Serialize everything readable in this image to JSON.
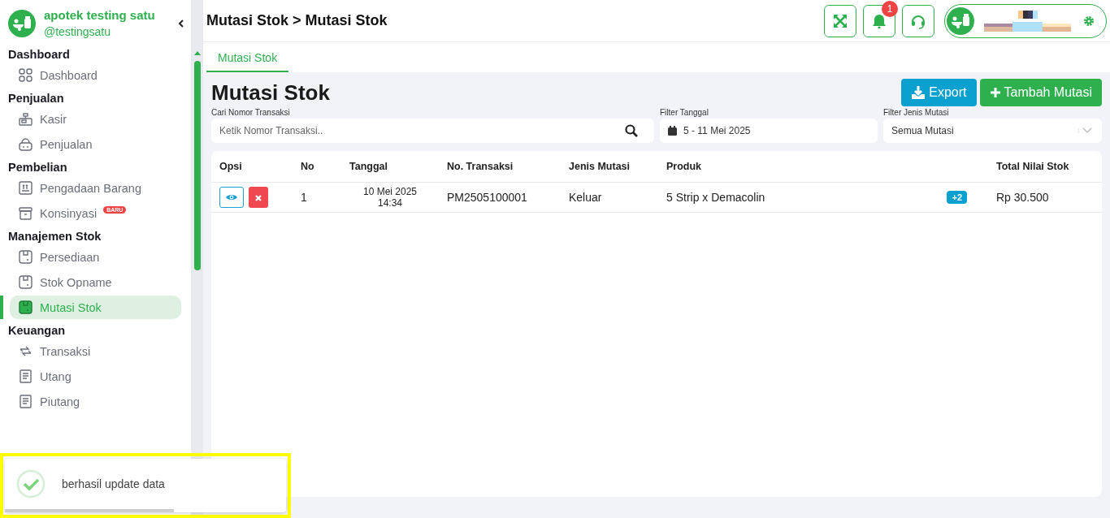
{
  "brand": {
    "name": "apotek testing satu",
    "handle": "@testingsatu"
  },
  "sidebar": {
    "sections": [
      {
        "title": "Dashboard",
        "items": [
          {
            "label": "Dashboard",
            "selected": false
          }
        ]
      },
      {
        "title": "Penjualan",
        "items": [
          {
            "label": "Kasir",
            "selected": false
          },
          {
            "label": "Penjualan",
            "selected": false
          }
        ]
      },
      {
        "title": "Pembelian",
        "items": [
          {
            "label": "Pengadaan Barang",
            "selected": false
          },
          {
            "label": "Konsinyasi",
            "badge": "BARU",
            "selected": false
          }
        ]
      },
      {
        "title": "Manajemen Stok",
        "items": [
          {
            "label": "Persediaan",
            "selected": false
          },
          {
            "label": "Stok Opname",
            "selected": false
          },
          {
            "label": "Mutasi Stok",
            "selected": true
          }
        ]
      },
      {
        "title": "Keuangan",
        "items": [
          {
            "label": "Transaksi",
            "selected": false
          },
          {
            "label": "Utang",
            "selected": false
          },
          {
            "label": "Piutang",
            "selected": false
          }
        ]
      }
    ]
  },
  "header": {
    "breadcrumb": "Mutasi Stok > Mutasi Stok",
    "notification_count": "1"
  },
  "tabs": [
    {
      "label": "Mutasi Stok",
      "selected": true
    }
  ],
  "page": {
    "title": "Mutasi Stok",
    "buttons": [
      {
        "kind": "export",
        "label": "Export"
      },
      {
        "kind": "add",
        "label": "Tambah Mutasi"
      }
    ],
    "filters": {
      "search": {
        "label": "Cari Nomor Transaksi",
        "placeholder": "Ketik Nomor Transaksi.."
      },
      "date": {
        "label": "Filter Tanggal",
        "value": "5 - 11 Mei 2025"
      },
      "type": {
        "label": "Filter Jenis Mutasi",
        "value": "Semua Mutasi"
      }
    }
  },
  "table": {
    "columns": [
      "Opsi",
      "No",
      "Tanggal",
      "No. Transaksi",
      "Jenis Mutasi",
      "Produk",
      "Total Nilai Stok"
    ],
    "rows": [
      {
        "no": "1",
        "date": "10 Mei 2025",
        "time": "14:34",
        "transaction": "PM2505100001",
        "type": "Keluar",
        "product": "5 Strip x Demacolin",
        "more": "+2",
        "total": "Rp 30.500"
      }
    ]
  },
  "toast": {
    "message": "berhasil update data",
    "level": 0.6
  }
}
